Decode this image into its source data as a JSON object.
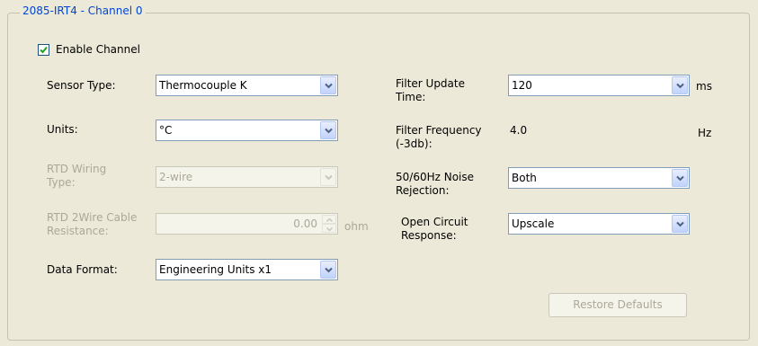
{
  "group_title": "2085-IRT4 - Channel 0",
  "enable_channel": {
    "label": "Enable Channel",
    "checked": true
  },
  "sensor_type": {
    "label": "Sensor Type:",
    "value": "Thermocouple K"
  },
  "units": {
    "label": "Units:",
    "value": "°C"
  },
  "rtd_wiring_type": {
    "label_line1": "RTD Wiring",
    "label_line2": "Type:",
    "value": "2-wire",
    "enabled": false
  },
  "rtd_cable_resistance": {
    "label_line1": "RTD 2Wire Cable",
    "label_line2": "Resistance:",
    "value": "0.00",
    "unit": "ohm",
    "enabled": false
  },
  "data_format": {
    "label": "Data Format:",
    "value": "Engineering Units x1"
  },
  "filter_update_time": {
    "label_line1": "Filter Update",
    "label_line2": "Time:",
    "value": "120",
    "unit": "ms"
  },
  "filter_frequency": {
    "label_line1": "Filter Frequency",
    "label_line2": "(-3db):",
    "value": "4.0",
    "unit": "Hz"
  },
  "noise_rejection": {
    "label_line1": "50/60Hz Noise",
    "label_line2": "Rejection:",
    "value": "Both"
  },
  "open_circuit_response": {
    "label_line1": "Open Circuit",
    "label_line2": "Response:",
    "value": "Upscale"
  },
  "restore_defaults": {
    "label": "Restore Defaults",
    "enabled": false
  },
  "colors": {
    "title_blue": "#0046d5",
    "panel_bg": "#ece9d8",
    "disabled_text": "#aca899",
    "input_border": "#7f9db9",
    "check_green": "#21a121"
  }
}
